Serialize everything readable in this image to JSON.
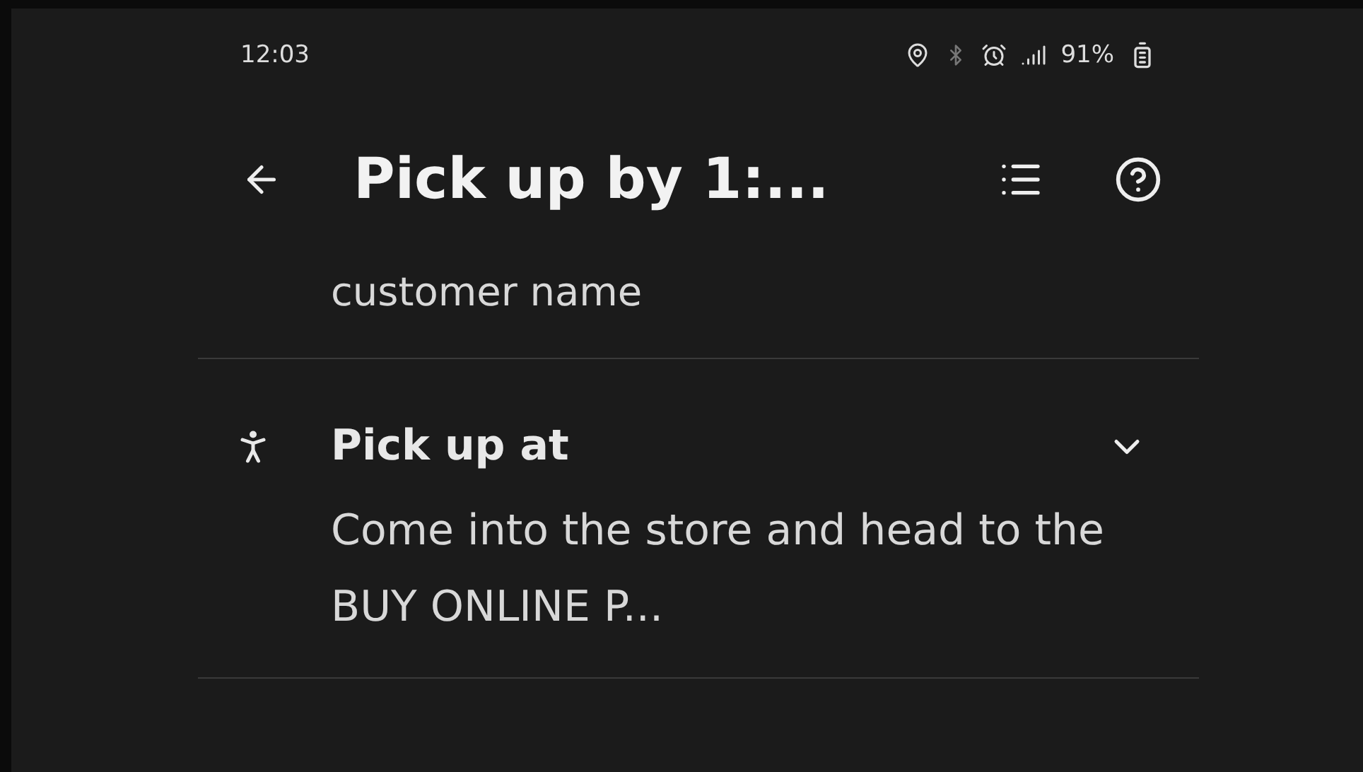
{
  "status_bar": {
    "time": "12:03",
    "battery": "91%"
  },
  "header": {
    "title": "Pick up by 1:..."
  },
  "customer": {
    "name": "customer name"
  },
  "section": {
    "title": "Pick up at",
    "body": "Come into the store and head to the BUY ONLINE P..."
  }
}
